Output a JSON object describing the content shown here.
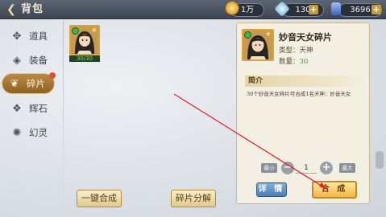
{
  "header": {
    "title": "背包",
    "back_icon": "back-arrow-icon",
    "resources": [
      {
        "icon": "gold-coin-icon",
        "value": "1万",
        "color": "#e0b243"
      },
      {
        "icon": "diamond-icon",
        "value": "130",
        "color": "#8fd0f0"
      },
      {
        "icon": "stamina-potion-icon",
        "value": "3696",
        "color": "#6b8fd0"
      }
    ]
  },
  "sidebar": {
    "items": [
      {
        "label": "道具",
        "icon": "items-icon",
        "active": false
      },
      {
        "label": "装备",
        "icon": "equipment-icon",
        "active": false
      },
      {
        "label": "碎片",
        "icon": "fragment-icon",
        "active": true
      },
      {
        "label": "辉石",
        "icon": "gem-icon",
        "active": false
      },
      {
        "label": "幻灵",
        "icon": "spirit-icon",
        "active": false
      }
    ]
  },
  "grid": {
    "items": [
      {
        "quantity_label": "30/30"
      }
    ]
  },
  "bottom_buttons": {
    "merge_all": "一键合成",
    "decompose": "碎片分解"
  },
  "detail": {
    "name": "妙音天女碎片",
    "type_label": "类型：",
    "type_value": "天神",
    "qty_label": "数量：",
    "qty_value": "30",
    "intro_title": "简介",
    "intro_text": "30个妙音天女碎片可合成1名天神：妙音天女",
    "min_label": "最小",
    "max_label": "最大",
    "minus": "−",
    "plus": "+",
    "quantity": "1",
    "details_button": "详 情",
    "merge_button": "合 成"
  },
  "colors": {
    "accent_gold": "#d7a63a",
    "active_tab": "#a8772f",
    "annotation_arrow": "#e02020"
  }
}
